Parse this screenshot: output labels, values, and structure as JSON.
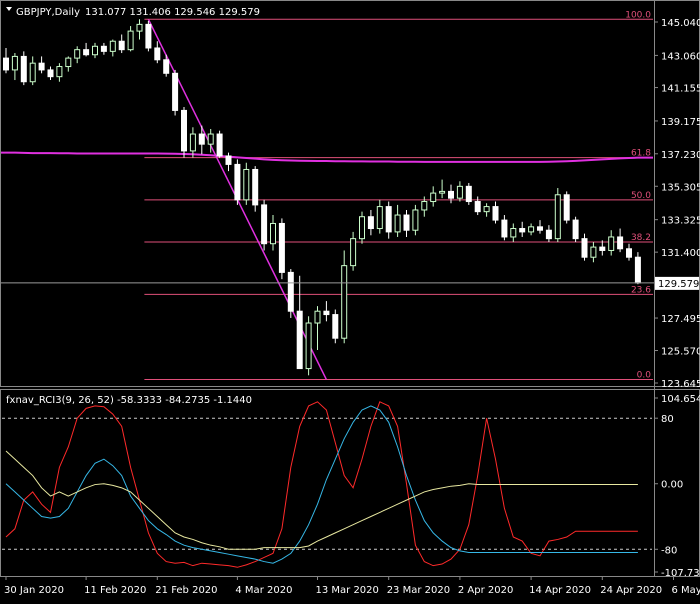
{
  "header": {
    "symbol_timeframe": "GBPJPY,Daily",
    "ohlc": "131.077 131.406 129.546 129.579"
  },
  "indicator": {
    "label": "fxnav_RCI3(9, 26, 52) -58.3333 -84.2735 -1.1440",
    "axis_labels": [
      {
        "text": "104.6543",
        "value": 104.6543
      },
      {
        "text": "80",
        "value": 80
      },
      {
        "text": "0.00",
        "value": 0
      },
      {
        "text": "-80",
        "value": -80
      },
      {
        "text": "-107.7397",
        "value": -107.7397
      }
    ]
  },
  "price_axis": {
    "labels": [
      {
        "text": "145.040",
        "value": 145.04
      },
      {
        "text": "143.060",
        "value": 143.06
      },
      {
        "text": "141.155",
        "value": 141.155
      },
      {
        "text": "139.175",
        "value": 139.175
      },
      {
        "text": "137.230",
        "value": 137.23
      },
      {
        "text": "135.305",
        "value": 135.305
      },
      {
        "text": "133.325",
        "value": 133.325
      },
      {
        "text": "131.400",
        "value": 131.4
      },
      {
        "text": "127.495",
        "value": 127.495
      },
      {
        "text": "125.570",
        "value": 125.57
      },
      {
        "text": "123.645",
        "value": 123.645
      }
    ],
    "current_price": "129.579"
  },
  "fibonacci": {
    "levels": [
      {
        "label": "100.0",
        "price": 145.2
      },
      {
        "label": "61.8",
        "price": 137.0
      },
      {
        "label": "50.0",
        "price": 134.5
      },
      {
        "label": "38.2",
        "price": 132.0
      },
      {
        "label": "23.6",
        "price": 128.9
      },
      {
        "label": "0.0",
        "price": 123.85
      }
    ]
  },
  "time_axis": {
    "labels": [
      {
        "text": "30 Jan 2020",
        "bar": 0
      },
      {
        "text": "11 Feb 2020",
        "bar": 9
      },
      {
        "text": "21 Feb 2020",
        "bar": 17
      },
      {
        "text": "4 Mar 2020",
        "bar": 26
      },
      {
        "text": "13 Mar 2020",
        "bar": 35
      },
      {
        "text": "23 Mar 2020",
        "bar": 43
      },
      {
        "text": "2 Apr 2020",
        "bar": 51
      },
      {
        "text": "14 Apr 2020",
        "bar": 59
      },
      {
        "text": "24 Apr 2020",
        "bar": 67
      },
      {
        "text": "6 May 2020",
        "bar": 75
      }
    ]
  },
  "colors": {
    "bull_candle": "#ccffcc",
    "bear_candle": "#ffffff",
    "fib_line": "#e0507a",
    "ma_line": "#e030e0",
    "trend_line": "#e030e0",
    "rci_short": "#ff2a2a",
    "rci_mid": "#36b7e6",
    "rci_long": "#e8e8a0",
    "axis_text": "#ffffff",
    "grid": "#888888"
  },
  "chart_data": [
    {
      "type": "candlestick",
      "title": "GBPJPY,Daily",
      "ylim": [
        123.645,
        145.04
      ],
      "ohlc": [
        [
          142.9,
          143.5,
          142.0,
          142.2
        ],
        [
          142.2,
          143.2,
          141.6,
          143.0
        ],
        [
          143.0,
          143.3,
          141.3,
          141.5
        ],
        [
          141.5,
          143.0,
          141.3,
          142.6
        ],
        [
          142.6,
          143.0,
          142.0,
          142.2
        ],
        [
          142.2,
          142.4,
          141.6,
          141.8
        ],
        [
          141.8,
          142.6,
          141.5,
          142.4
        ],
        [
          142.4,
          143.0,
          142.1,
          142.9
        ],
        [
          142.9,
          143.6,
          142.6,
          143.4
        ],
        [
          143.4,
          143.8,
          143.0,
          143.1
        ],
        [
          143.1,
          143.8,
          142.9,
          143.6
        ],
        [
          143.6,
          143.8,
          143.1,
          143.3
        ],
        [
          143.3,
          144.0,
          143.0,
          143.9
        ],
        [
          143.9,
          144.3,
          143.2,
          143.4
        ],
        [
          143.4,
          144.8,
          143.3,
          144.5
        ],
        [
          144.5,
          145.2,
          144.0,
          144.9
        ],
        [
          144.9,
          145.1,
          143.3,
          143.5
        ],
        [
          143.5,
          143.9,
          142.6,
          142.8
        ],
        [
          142.8,
          143.1,
          141.8,
          142.0
        ],
        [
          142.0,
          142.2,
          139.5,
          139.8
        ],
        [
          139.8,
          140.0,
          137.0,
          137.4
        ],
        [
          137.4,
          138.8,
          137.0,
          138.4
        ],
        [
          138.4,
          138.9,
          137.2,
          137.8
        ],
        [
          137.8,
          138.7,
          137.3,
          138.4
        ],
        [
          138.4,
          138.6,
          137.0,
          137.1
        ],
        [
          137.1,
          137.3,
          136.2,
          136.6
        ],
        [
          136.6,
          136.9,
          134.2,
          134.5
        ],
        [
          134.5,
          136.7,
          134.2,
          136.3
        ],
        [
          136.3,
          136.5,
          133.8,
          134.2
        ],
        [
          134.2,
          134.5,
          131.5,
          131.9
        ],
        [
          131.9,
          133.6,
          131.5,
          133.1
        ],
        [
          133.1,
          133.4,
          129.8,
          130.2
        ],
        [
          130.2,
          130.4,
          127.5,
          127.9
        ],
        [
          127.9,
          130.0,
          125.0,
          124.5
        ],
        [
          124.5,
          127.6,
          124.1,
          127.2
        ],
        [
          127.2,
          128.2,
          125.6,
          127.9
        ],
        [
          127.9,
          128.5,
          127.3,
          127.7
        ],
        [
          127.7,
          128.0,
          126.0,
          126.3
        ],
        [
          126.3,
          131.5,
          126.0,
          130.6
        ],
        [
          130.6,
          132.6,
          130.3,
          132.2
        ],
        [
          132.2,
          133.8,
          131.9,
          133.5
        ],
        [
          133.5,
          133.9,
          132.4,
          132.8
        ],
        [
          132.8,
          134.5,
          132.5,
          134.1
        ],
        [
          134.1,
          134.4,
          132.2,
          132.6
        ],
        [
          132.6,
          134.2,
          132.3,
          133.6
        ],
        [
          133.6,
          133.9,
          132.3,
          132.7
        ],
        [
          132.7,
          134.2,
          132.4,
          133.9
        ],
        [
          133.9,
          134.7,
          133.5,
          134.4
        ],
        [
          134.4,
          135.3,
          134.1,
          134.9
        ],
        [
          134.9,
          135.7,
          134.6,
          135.0
        ],
        [
          135.0,
          135.4,
          134.3,
          134.6
        ],
        [
          134.6,
          135.6,
          134.4,
          135.3
        ],
        [
          135.3,
          135.5,
          134.2,
          134.4
        ],
        [
          134.4,
          134.7,
          133.6,
          133.8
        ],
        [
          133.8,
          134.3,
          133.5,
          134.1
        ],
        [
          134.1,
          134.4,
          133.1,
          133.3
        ],
        [
          133.3,
          133.6,
          132.1,
          132.3
        ],
        [
          132.3,
          133.1,
          132.0,
          132.8
        ],
        [
          132.8,
          133.2,
          132.3,
          132.6
        ],
        [
          132.6,
          133.1,
          132.4,
          132.9
        ],
        [
          132.9,
          133.3,
          132.5,
          132.7
        ],
        [
          132.7,
          133.0,
          132.0,
          132.2
        ],
        [
          132.2,
          135.2,
          132.0,
          134.8
        ],
        [
          134.8,
          135.0,
          133.1,
          133.3
        ],
        [
          133.3,
          133.5,
          132.0,
          132.2
        ],
        [
          132.2,
          132.5,
          130.9,
          131.1
        ],
        [
          131.1,
          132.0,
          130.8,
          131.7
        ],
        [
          131.7,
          132.1,
          131.2,
          131.5
        ],
        [
          131.5,
          132.7,
          131.2,
          132.3
        ],
        [
          132.3,
          132.8,
          131.4,
          131.6
        ],
        [
          131.6,
          131.9,
          130.9,
          131.1
        ],
        [
          131.1,
          131.4,
          129.5,
          129.579
        ]
      ],
      "moving_average": [
        137.3,
        137.3,
        137.28,
        137.27,
        137.27,
        137.27,
        137.26,
        137.26,
        137.25,
        137.25,
        137.25,
        137.25,
        137.25,
        137.25,
        137.25,
        137.25,
        137.25,
        137.25,
        137.24,
        137.23,
        137.22,
        137.2,
        137.17,
        137.14,
        137.1,
        137.06,
        137.02,
        136.98,
        136.94,
        136.9,
        136.87,
        136.85,
        136.83,
        136.82,
        136.81,
        136.8,
        136.8,
        136.79,
        136.79,
        136.78,
        136.78,
        136.77,
        136.77,
        136.77,
        136.76,
        136.76,
        136.76,
        136.75,
        136.75,
        136.75,
        136.75,
        136.75,
        136.75,
        136.75,
        136.75,
        136.75,
        136.75,
        136.75,
        136.75,
        136.75,
        136.75,
        136.76,
        136.77,
        136.79,
        136.81,
        136.84,
        136.87,
        136.9,
        136.93,
        136.96,
        136.98,
        137.0
      ],
      "trend_line": [
        [
          16,
          145.2
        ],
        [
          36,
          123.85
        ]
      ]
    },
    {
      "type": "line",
      "title": "fxnav_RCI3(9, 26, 52)",
      "ylim": [
        -107.7397,
        104.6543
      ],
      "series": [
        {
          "values": [
            -65,
            -55,
            -20,
            -10,
            -25,
            -35,
            20,
            45,
            80,
            92,
            95,
            94,
            85,
            70,
            20,
            -20,
            -60,
            -85,
            -95,
            -97,
            -96,
            -100,
            -97,
            -98,
            -99,
            -100,
            -102,
            -99,
            -95,
            -90,
            -85,
            -55,
            20,
            70,
            95,
            100,
            90,
            50,
            10,
            -5,
            30,
            70,
            100,
            95,
            70,
            0,
            -75,
            -95,
            -100,
            -98,
            -92,
            -80,
            -50,
            10,
            80,
            30,
            -30,
            -65,
            -70,
            -85,
            -88,
            -70,
            -68,
            -65,
            -58,
            -58,
            -58,
            -58,
            -58,
            -58,
            -58,
            -58
          ]
        },
        {
          "values": [
            0,
            -10,
            -20,
            -30,
            -40,
            -42,
            -40,
            -30,
            -10,
            10,
            25,
            30,
            22,
            10,
            -15,
            -30,
            -45,
            -55,
            -62,
            -70,
            -75,
            -78,
            -80,
            -82,
            -84,
            -86,
            -88,
            -90,
            -92,
            -95,
            -97,
            -92,
            -85,
            -70,
            -50,
            -25,
            5,
            30,
            55,
            75,
            90,
            95,
            90,
            75,
            45,
            10,
            -20,
            -45,
            -60,
            -70,
            -78,
            -82,
            -84,
            -84,
            -84,
            -84,
            -84,
            -84,
            -84,
            -84,
            -84,
            -84,
            -84,
            -84,
            -84,
            -84,
            -84,
            -84,
            -84,
            -84,
            -84,
            -84
          ]
        },
        {
          "values": [
            40,
            30,
            20,
            10,
            -5,
            -15,
            -10,
            -15,
            -10,
            -5,
            -1,
            0,
            -2,
            -5,
            -10,
            -20,
            -30,
            -40,
            -50,
            -60,
            -65,
            -68,
            -72,
            -75,
            -77,
            -80,
            -80,
            -80,
            -80,
            -78,
            -78,
            -78,
            -78,
            -78,
            -76,
            -70,
            -65,
            -60,
            -55,
            -50,
            -45,
            -40,
            -35,
            -30,
            -25,
            -20,
            -15,
            -10,
            -7,
            -5,
            -3,
            -2,
            0,
            -1,
            -1,
            -1,
            -1,
            -1,
            -1,
            -1,
            -1,
            -1,
            -1,
            -1,
            -1,
            -1,
            -1,
            -1,
            -1,
            -1,
            -1,
            -1
          ]
        }
      ]
    }
  ]
}
